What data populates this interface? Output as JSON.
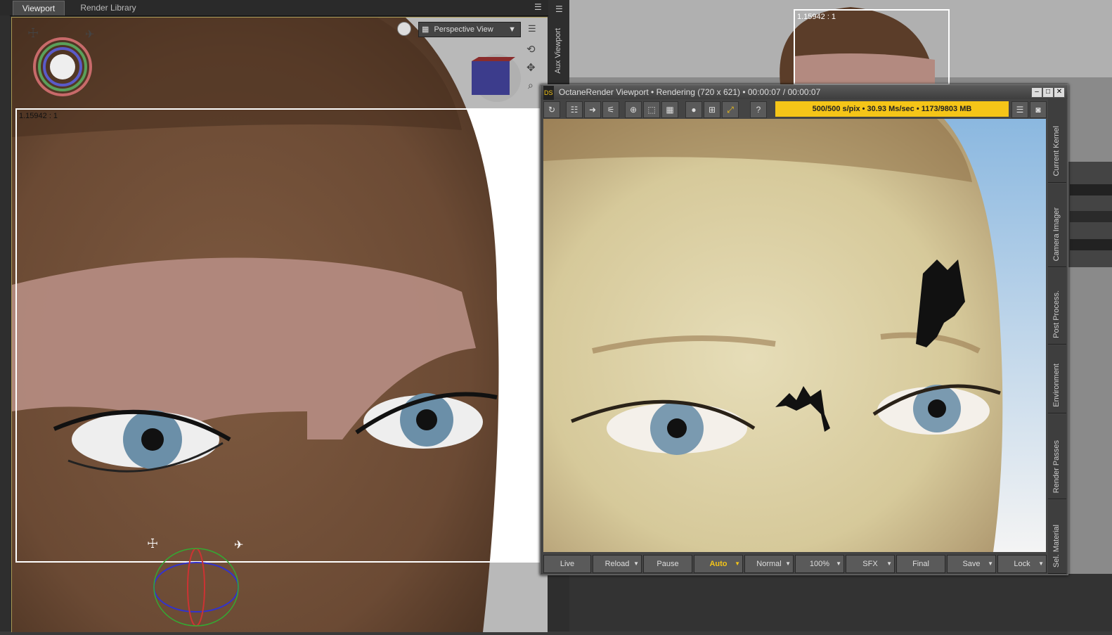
{
  "viewport_panel": {
    "tabs": [
      {
        "label": "Viewport",
        "active": true
      },
      {
        "label": "Render Library",
        "active": false
      }
    ],
    "camera_dropdown": "Perspective View",
    "frame_ratio": "1.15942 : 1"
  },
  "aux_viewport": {
    "tab_label": "Aux Viewport",
    "frame_ratio": "1.15942 : 1"
  },
  "octane": {
    "title": "OctaneRender Viewport • Rendering (720 x 621) • 00:00:07 / 00:00:07",
    "status": "500/500 s/pix • 30.93 Ms/sec • 1173/9803 MB",
    "status_color": "#f5c518",
    "bottom_buttons": [
      {
        "label": "Live",
        "dropdown": false
      },
      {
        "label": "Reload",
        "dropdown": true
      },
      {
        "label": "Pause",
        "dropdown": false
      },
      {
        "label": "Auto",
        "dropdown": true,
        "highlight": true
      },
      {
        "label": "Normal",
        "dropdown": true
      },
      {
        "label": "100%",
        "dropdown": true
      },
      {
        "label": "SFX",
        "dropdown": true
      },
      {
        "label": "Final",
        "dropdown": false
      },
      {
        "label": "Save",
        "dropdown": true
      },
      {
        "label": "Lock",
        "dropdown": true
      }
    ],
    "side_tabs": [
      "Current Kernel",
      "Camera Imager",
      "Post Process.",
      "Environment",
      "Render Passes",
      "Sel. Material"
    ]
  }
}
